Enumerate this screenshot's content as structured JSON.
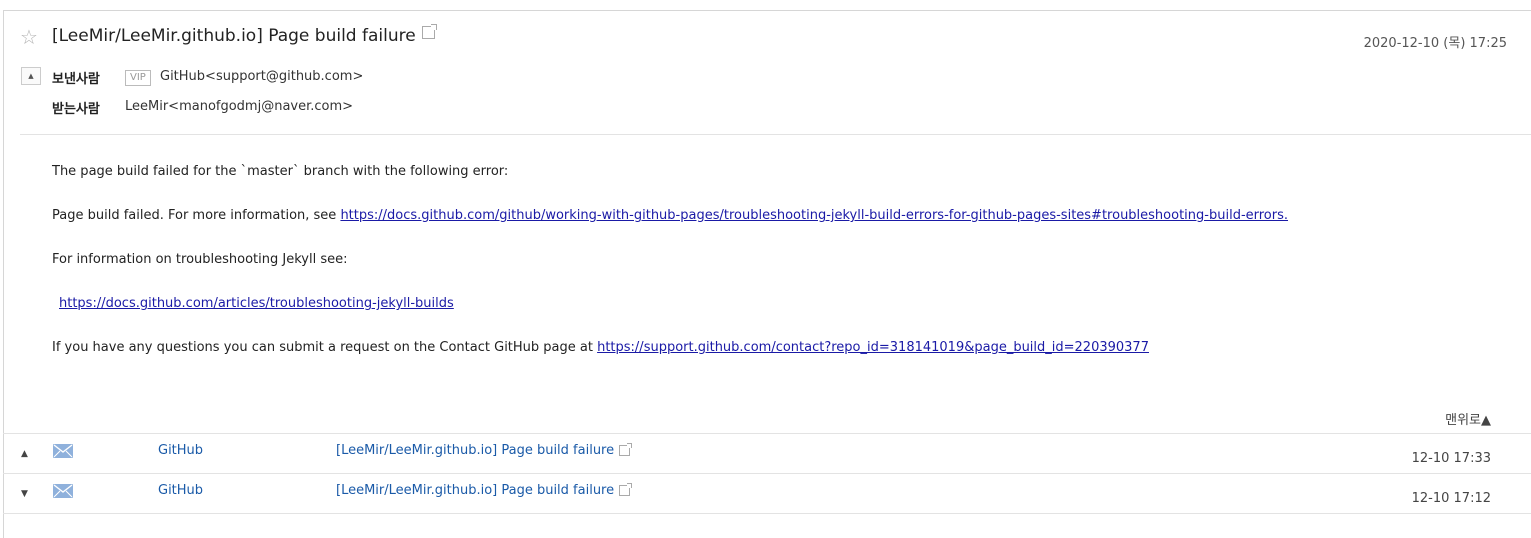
{
  "mail": {
    "subject": "[LeeMir/LeeMir.github.io] Page build failure",
    "date": "2020-12-10 (목) 17:25",
    "sender_label": "보낸사람",
    "vip_badge": "VIP",
    "sender": "GitHub<support@github.com>",
    "recipient_label": "받는사람",
    "recipient": "LeeMir<manofgodmj@naver.com>"
  },
  "body": {
    "line1": "The page build failed for the `master` branch with the following error:",
    "line2_prefix": "Page build failed. For more information, see ",
    "line2_link": "https://docs.github.com/github/working-with-github-pages/troubleshooting-jekyll-build-errors-for-github-pages-sites#troubleshooting-build-errors.",
    "line3": "For information on troubleshooting Jekyll see:",
    "line4_link": "https://docs.github.com/articles/troubleshooting-jekyll-builds",
    "line5_prefix": "If you have any questions you can submit a request on the Contact GitHub page at ",
    "line5_link": "https://support.github.com/contact?repo_id=318141019&page_build_id=220390377"
  },
  "top_link": "맨위로▲",
  "thread": [
    {
      "arrow": "▲",
      "sender": "GitHub",
      "subject": "[LeeMir/LeeMir.github.io] Page build failure",
      "date": "12-10 17:33"
    },
    {
      "arrow": "▼",
      "sender": "GitHub",
      "subject": "[LeeMir/LeeMir.github.io] Page build failure",
      "date": "12-10 17:12"
    }
  ],
  "icons": {
    "star": "star-icon",
    "external": "external-link-icon",
    "collapse": "collapse-icon",
    "mail": "envelope-icon"
  }
}
